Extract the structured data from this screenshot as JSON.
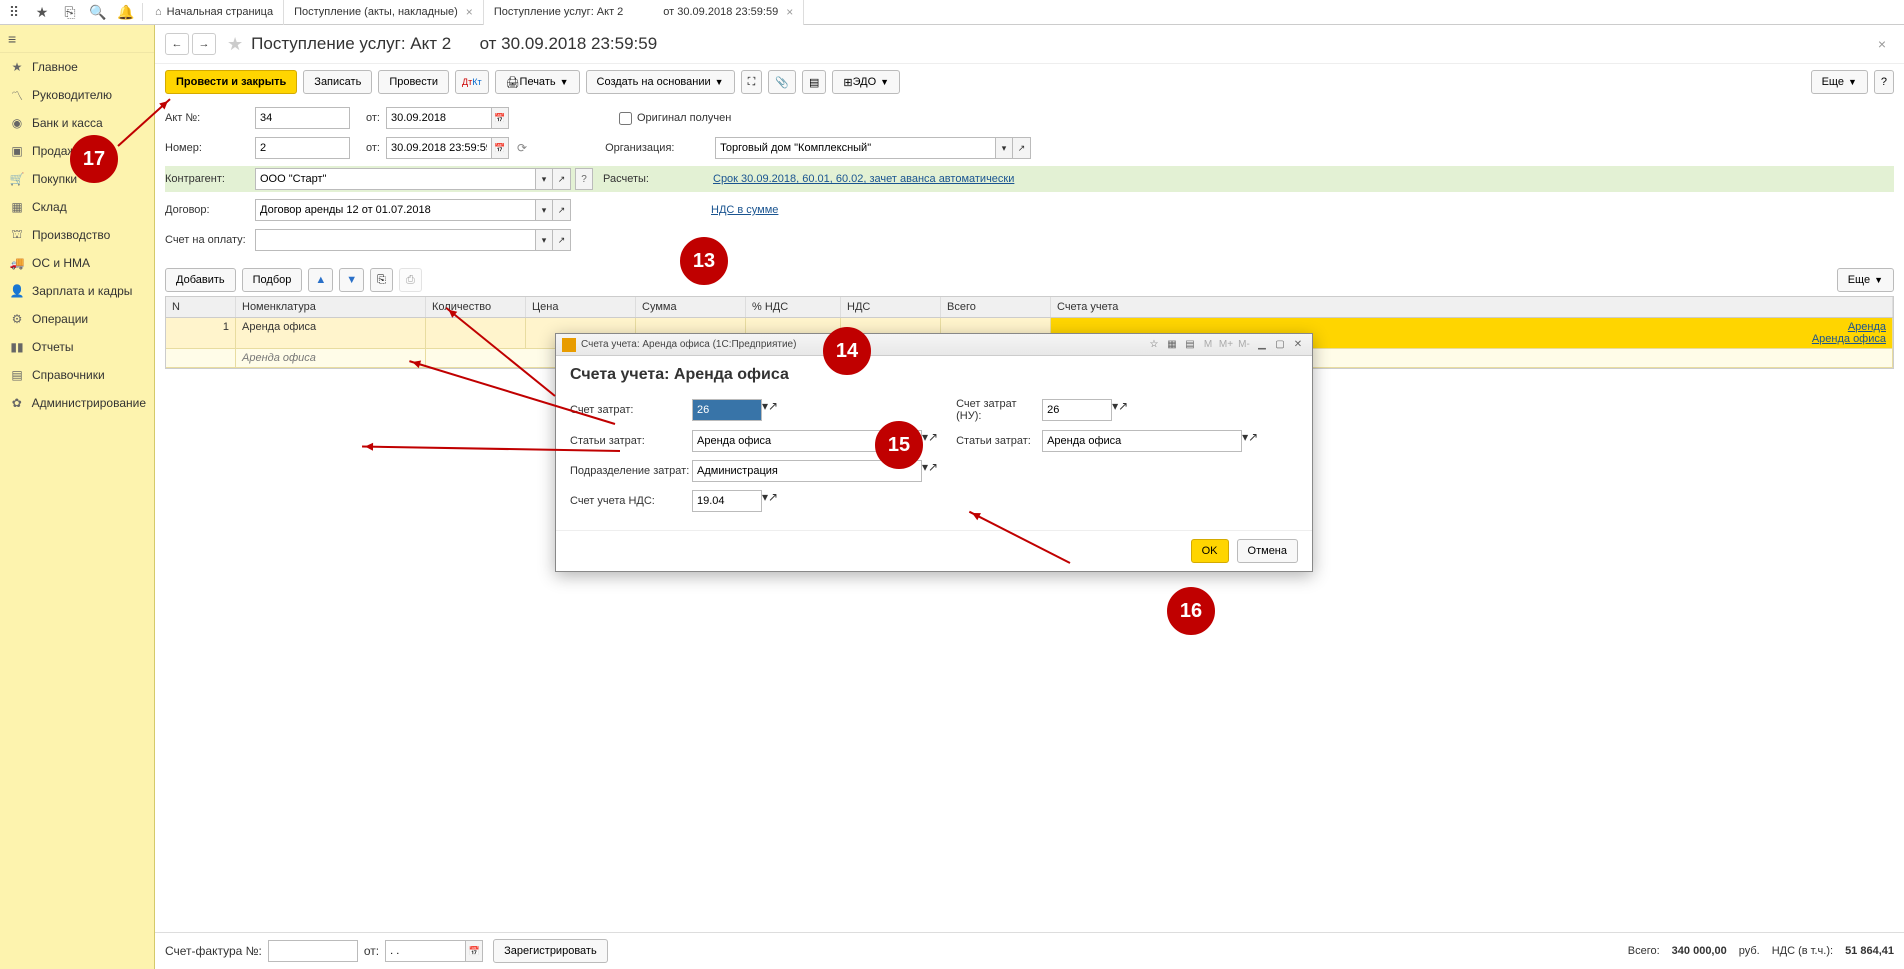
{
  "topbar": {
    "tabs": [
      {
        "label": "Начальная страница"
      },
      {
        "label": "Поступление (акты, накладные)"
      },
      {
        "label": "Поступление услуг: Акт 2"
      },
      {
        "label": "от 30.09.2018 23:59:59"
      }
    ]
  },
  "sidebar": {
    "items": [
      {
        "icon": "≡",
        "label": "Главное"
      },
      {
        "icon": "📈",
        "label": "Руководителю"
      },
      {
        "icon": "💰",
        "label": "Банк и касса"
      },
      {
        "icon": "🏷",
        "label": "Продажи"
      },
      {
        "icon": "🛒",
        "label": "Покупки"
      },
      {
        "icon": "📦",
        "label": "Склад"
      },
      {
        "icon": "🏭",
        "label": "Производство"
      },
      {
        "icon": "🚚",
        "label": "ОС и НМА"
      },
      {
        "icon": "👤",
        "label": "Зарплата и кадры"
      },
      {
        "icon": "⚙",
        "label": "Операции"
      },
      {
        "icon": "📊",
        "label": "Отчеты"
      },
      {
        "icon": "📚",
        "label": "Справочники"
      },
      {
        "icon": "✿",
        "label": "Администрирование"
      }
    ]
  },
  "title": {
    "main": "Поступление услуг: Акт 2",
    "sub": "от 30.09.2018 23:59:59"
  },
  "toolbar": {
    "post_close": "Провести и закрыть",
    "write": "Записать",
    "post": "Провести",
    "print": "Печать",
    "create_based": "Создать на основании",
    "edo": "ЭДО",
    "more": "Еще"
  },
  "form": {
    "act_no_label": "Акт №:",
    "act_no_value": "34",
    "from_label": "от:",
    "act_date": "30.09.2018",
    "number_label": "Номер:",
    "number_value": "2",
    "number_date": "30.09.2018 23:59:59",
    "original_label": "Оригинал получен",
    "org_label": "Организация:",
    "org_value": "Торговый дом \"Комплексный\"",
    "contractor_label": "Контрагент:",
    "contractor_value": "ООО \"Старт\"",
    "calc_label": "Расчеты:",
    "calc_link": "Срок 30.09.2018, 60.01, 60.02, зачет аванса автоматически",
    "contract_label": "Договор:",
    "contract_value": "Договор аренды 12 от 01.07.2018",
    "nds_link": "НДС в сумме",
    "invoice_label": "Счет на оплату:",
    "add": "Добавить",
    "select": "Подбор"
  },
  "table": {
    "headers": {
      "n": "N",
      "nomenclature": "Номенклатура",
      "qty": "Количество",
      "price": "Цена",
      "sum": "Сумма",
      "vat_pct": "% НДС",
      "vat": "НДС",
      "total": "Всего",
      "accounts": "Счета учета"
    },
    "row1": {
      "n": "1",
      "name": "Аренда офиса",
      "acct1": "Аренда",
      "acct2": "Аренда офиса"
    },
    "row2": {
      "name": "Аренда офиса"
    }
  },
  "modal": {
    "title_bar": "Счета учета: Аренда офиса  (1С:Предприятие)",
    "title": "Счета учета: Аренда офиса",
    "cost_acct_label": "Счет затрат:",
    "cost_acct_value": "26",
    "cost_item_label": "Статьи затрат:",
    "cost_item_value": "Аренда офиса",
    "dept_label": "Подразделение затрат:",
    "dept_value": "Администрация",
    "vat_acct_label": "Счет учета НДС:",
    "vat_acct_value": "19.04",
    "cost_acct_nu_label": "Счет затрат (НУ):",
    "cost_acct_nu_value": "26",
    "cost_item_nu_label": "Статьи затрат:",
    "cost_item_nu_value": "Аренда офиса",
    "ok": "OK",
    "cancel": "Отмена"
  },
  "footer": {
    "sf_label": "Счет-фактура №:",
    "from": "от:",
    "date_ph": ". .",
    "register": "Зарегистрировать",
    "total_label": "Всего:",
    "total_value": "340 000,00",
    "currency": "руб.",
    "vat_label": "НДС (в т.ч.):",
    "vat_value": "51 864,41"
  },
  "annotations": {
    "a13": "13",
    "a14": "14",
    "a15": "15",
    "a16": "16",
    "a17": "17"
  }
}
